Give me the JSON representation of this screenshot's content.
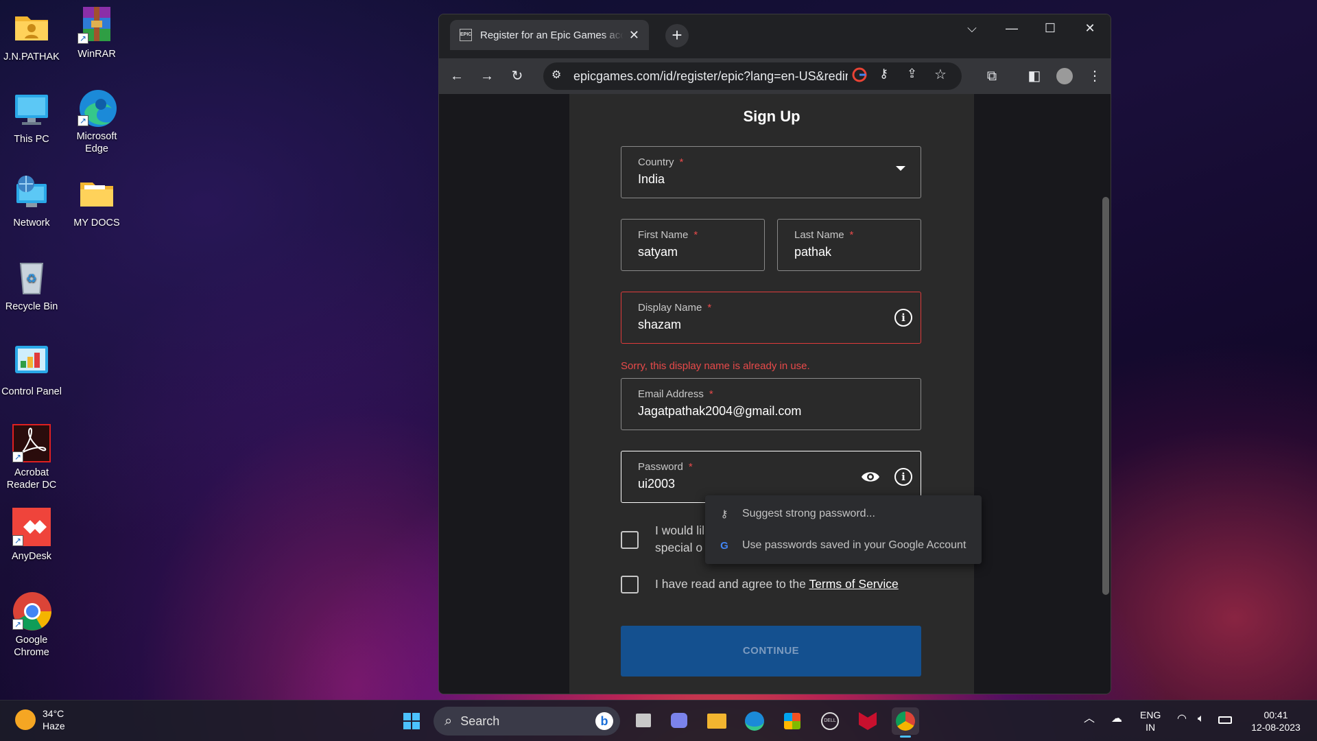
{
  "desktop": {
    "icons": [
      {
        "label": "J.N.PATHAK",
        "icon": "user-folder-icon"
      },
      {
        "label": "WinRAR",
        "icon": "winrar-icon"
      },
      {
        "label": "This PC",
        "icon": "monitor-icon"
      },
      {
        "label": "Microsoft Edge",
        "icon": "edge-icon"
      },
      {
        "label": "Network",
        "icon": "network-icon"
      },
      {
        "label": "MY DOCS",
        "icon": "folder-icon"
      },
      {
        "label": "Recycle Bin",
        "icon": "recycle-bin-icon"
      },
      {
        "label": "Control Panel",
        "icon": "control-panel-icon"
      },
      {
        "label": "Acrobat Reader DC",
        "icon": "acrobat-icon"
      },
      {
        "label": "AnyDesk",
        "icon": "anydesk-icon"
      },
      {
        "label": "Google Chrome",
        "icon": "chrome-icon"
      }
    ]
  },
  "browser": {
    "tab_title": "Register for an Epic Games account",
    "favicon_text": "EPIC",
    "url": "epicgames.com/id/register/epic?lang=en-US&redirect_uri=https"
  },
  "form": {
    "heading": "Sign Up",
    "country_label": "Country",
    "country_value": "India",
    "first_name_label": "First Name",
    "first_name_value": "satyam",
    "last_name_label": "Last Name",
    "last_name_value": "pathak",
    "display_name_label": "Display Name",
    "display_name_value": "shazam",
    "display_name_error": "Sorry, this display name is already in use.",
    "email_label": "Email Address",
    "email_value": "Jagatpathak2004@gmail.com",
    "password_label": "Password",
    "password_value": "ui2003",
    "required_mark": "*",
    "offers_text_line1": "I would lil",
    "offers_text_line2": "special o",
    "terms_text": "I have read and agree to the",
    "terms_link": "Terms of Service",
    "continue_label": "CONTINUE"
  },
  "password_popup": {
    "suggest": "Suggest strong password...",
    "saved": "Use passwords saved in your Google Account"
  },
  "taskbar": {
    "weather_temp": "34°C",
    "weather_desc": "Haze",
    "search_label": "Search",
    "lang": "ENG",
    "region": "IN",
    "time": "00:41",
    "date": "12-08-2023"
  },
  "colors": {
    "continue_button": "#14508f",
    "error": "#e84a4a",
    "page_bg": "#18181c",
    "card_bg": "#2a2a2a"
  }
}
